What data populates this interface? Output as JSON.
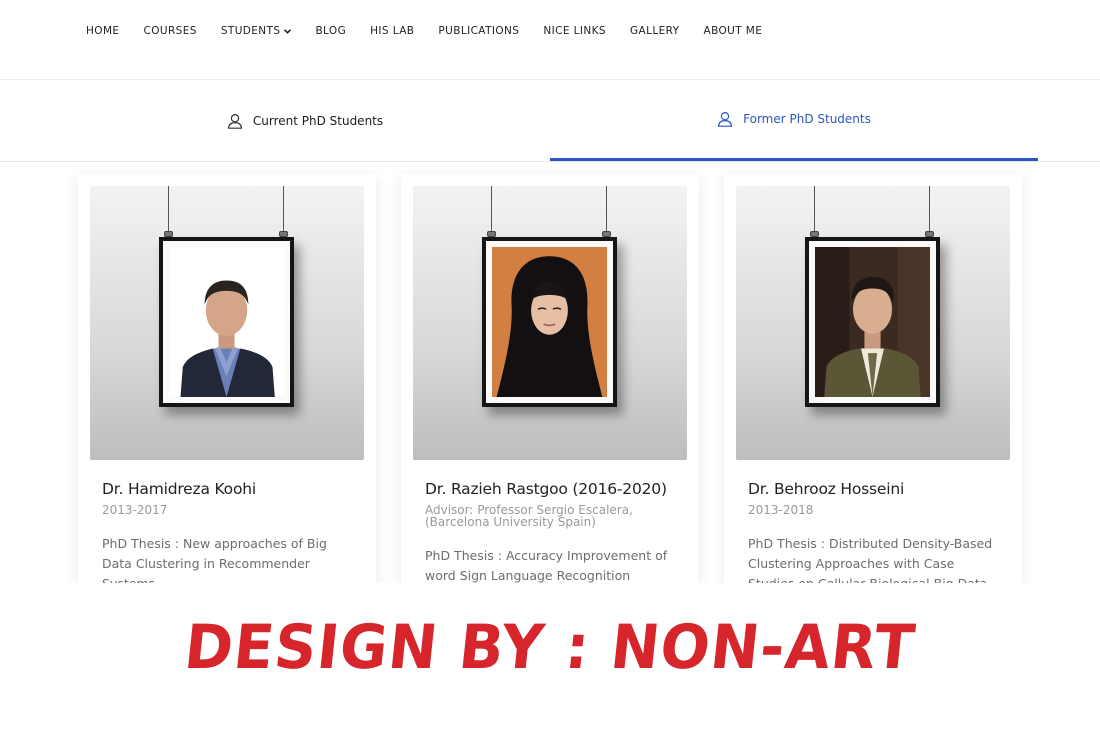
{
  "nav": {
    "items": [
      {
        "label": "HOME"
      },
      {
        "label": "COURSES"
      },
      {
        "label": "STUDENTS"
      },
      {
        "label": "BLOG"
      },
      {
        "label": "HIS LAB"
      },
      {
        "label": "PUBLICATIONS"
      },
      {
        "label": "NICE LINKS"
      },
      {
        "label": "GALLERY"
      },
      {
        "label": "ABOUT ME"
      }
    ]
  },
  "tabs": {
    "current": {
      "label": "Current PhD Students",
      "icon": "user-icon"
    },
    "former": {
      "label": "Former PhD Students",
      "icon": "user-icon",
      "active": true
    }
  },
  "colors": {
    "accent": "#2a56c6",
    "banner": "#d6262b"
  },
  "students": [
    {
      "name": "Dr. Hamidreza Koohi",
      "sub": "2013-2017",
      "desc": "PhD Thesis : New approaches of Big Data Clustering in Recommender Systems"
    },
    {
      "name": "Dr. Razieh Rastgoo (2016-2020)",
      "sub": "Advisor: Professor Sergio Escalera, (Barcelona University Spain)",
      "desc": "PhD Thesis : Accuracy Improvement of word Sign Language Recognition"
    },
    {
      "name": "Dr. Behrooz Hosseini",
      "sub": "2013-2018",
      "desc": "PhD Thesis : Distributed Density-Based Clustering Approaches with Case Studies on Cellular Biological Big Data"
    }
  ],
  "banner": {
    "text": "DESIGN BY : NON-ART"
  }
}
